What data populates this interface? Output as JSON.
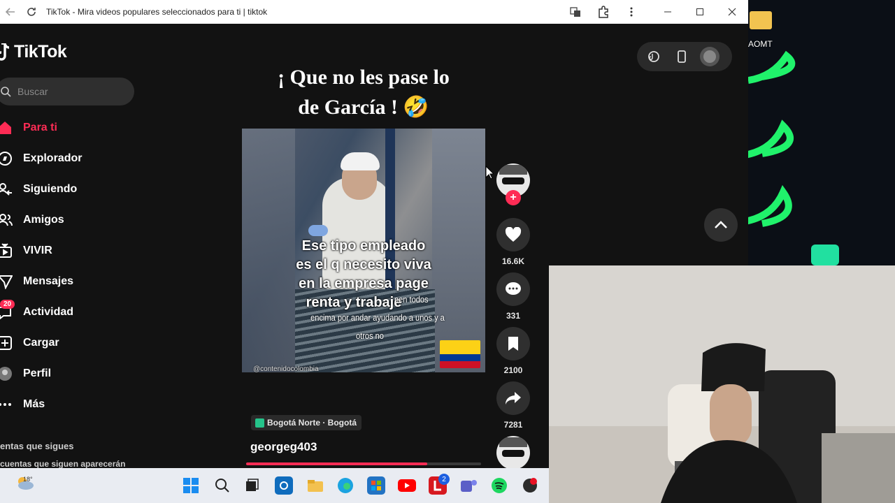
{
  "browser": {
    "title": "TikTok - Mira videos populares seleccionados para ti | tiktok"
  },
  "sidebar": {
    "logo": "TikTok",
    "search_placeholder": "Buscar",
    "items": [
      {
        "label": "Para ti",
        "icon": "home-icon",
        "active": true
      },
      {
        "label": "Explorador",
        "icon": "compass-icon"
      },
      {
        "label": "Siguiendo",
        "icon": "following-icon"
      },
      {
        "label": "Amigos",
        "icon": "friends-icon"
      },
      {
        "label": "VIVIR",
        "icon": "live-icon"
      },
      {
        "label": "Mensajes",
        "icon": "messages-icon"
      },
      {
        "label": "Actividad",
        "icon": "activity-icon",
        "badge": "20"
      },
      {
        "label": "Cargar",
        "icon": "upload-icon"
      },
      {
        "label": "Perfil",
        "icon": "profile-icon"
      },
      {
        "label": "Más",
        "icon": "more-icon"
      }
    ],
    "following_title": "entas que sigues",
    "following_sub": "cuentas que siguen aparecerán"
  },
  "video": {
    "title_line1": "¡ Que no les pase lo",
    "title_line2": "de García ! 🤣",
    "caption_big": [
      "Ese tipo empleado",
      "es el q necesito viva",
      "en la empresa page",
      "renta y trabaje"
    ],
    "caption_small": [
      "nen todos",
      "encima por andar ayudando a unos y a",
      "otros no"
    ],
    "watermark": "@contenidocolombia",
    "location": "Bogotá Norte · Bogotá",
    "username": "georgeg403",
    "progress": 0.77
  },
  "actions": {
    "likes": "16.6K",
    "comments": "331",
    "saves": "2100",
    "shares": "7281"
  },
  "desktop": {
    "folder_label": "AOMT"
  },
  "taskbar": {
    "weather_temp": "18°",
    "teams_badge": "2"
  },
  "colors": {
    "accent": "#fe2c55",
    "background": "#121212"
  }
}
